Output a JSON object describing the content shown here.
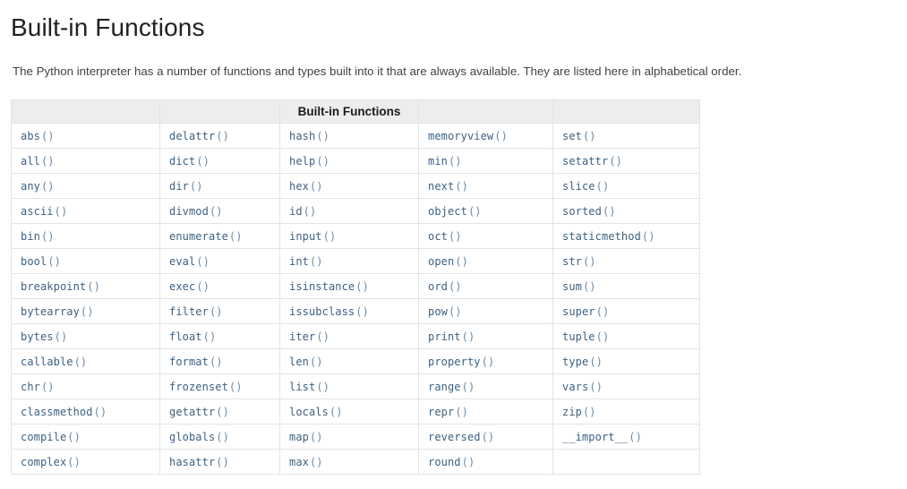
{
  "page": {
    "title": "Built-in Functions",
    "intro": "The Python interpreter has a number of functions and types built into it that are always available. They are listed here in alphabetical order.",
    "link_color": "#3c6183",
    "header_background": "#ededed",
    "border_color": "#e1e4e5"
  },
  "table": {
    "caption": "Built-in Functions",
    "header_cells": [
      "",
      "",
      "Built-in Functions",
      "",
      ""
    ],
    "columns": 5,
    "rows": [
      [
        "abs()",
        "delattr()",
        "hash()",
        "memoryview()",
        "set()"
      ],
      [
        "all()",
        "dict()",
        "help()",
        "min()",
        "setattr()"
      ],
      [
        "any()",
        "dir()",
        "hex()",
        "next()",
        "slice()"
      ],
      [
        "ascii()",
        "divmod()",
        "id()",
        "object()",
        "sorted()"
      ],
      [
        "bin()",
        "enumerate()",
        "input()",
        "oct()",
        "staticmethod()"
      ],
      [
        "bool()",
        "eval()",
        "int()",
        "open()",
        "str()"
      ],
      [
        "breakpoint()",
        "exec()",
        "isinstance()",
        "ord()",
        "sum()"
      ],
      [
        "bytearray()",
        "filter()",
        "issubclass()",
        "pow()",
        "super()"
      ],
      [
        "bytes()",
        "float()",
        "iter()",
        "print()",
        "tuple()"
      ],
      [
        "callable()",
        "format()",
        "len()",
        "property()",
        "type()"
      ],
      [
        "chr()",
        "frozenset()",
        "list()",
        "range()",
        "vars()"
      ],
      [
        "classmethod()",
        "getattr()",
        "locals()",
        "repr()",
        "zip()"
      ],
      [
        "compile()",
        "globals()",
        "map()",
        "reversed()",
        "__import__()"
      ],
      [
        "complex()",
        "hasattr()",
        "max()",
        "round()",
        ""
      ]
    ]
  }
}
